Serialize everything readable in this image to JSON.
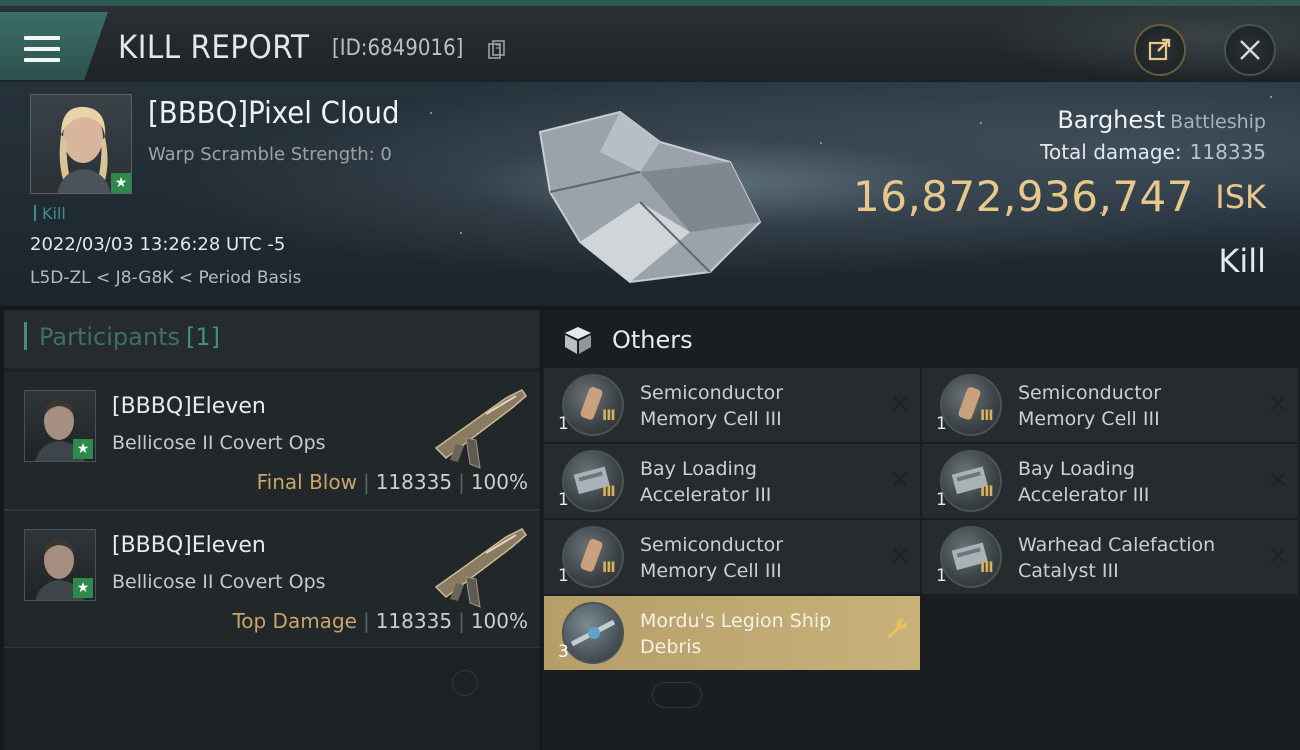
{
  "header": {
    "title": "KILL REPORT",
    "report_id": "[ID:6849016]"
  },
  "victim": {
    "name": "[BBBQ]Pixel Cloud",
    "warp_scramble": "Warp Scramble Strength: 0",
    "tag": "Kill",
    "timestamp": "2022/03/03 13:26:28 UTC -5",
    "location": "L5D-ZL < J8-G8K < Period Basis",
    "ship_name": "Barghest",
    "ship_class": "Battleship",
    "total_damage_label": "Total damage:",
    "total_damage_value": "118335",
    "isk_value": "16,872,936,747",
    "isk_unit": "ISK",
    "result": "Kill"
  },
  "participants": {
    "title": "Participants",
    "count": "[1]",
    "rows": [
      {
        "name": "[BBBQ]Eleven",
        "ship": "Bellicose II Covert Ops",
        "role": "Final Blow",
        "damage": "118335",
        "percent": "100%"
      },
      {
        "name": "[BBBQ]Eleven",
        "ship": "Bellicose II Covert Ops",
        "role": "Top Damage",
        "damage": "118335",
        "percent": "100%"
      }
    ]
  },
  "others": {
    "title": "Others",
    "items": [
      {
        "qty": "1",
        "line1": "Semiconductor",
        "line2": "Memory Cell III",
        "tier": "III",
        "icon": "memory-cell-icon"
      },
      {
        "qty": "1",
        "line1": "Semiconductor",
        "line2": "Memory Cell III",
        "tier": "III",
        "icon": "memory-cell-icon"
      },
      {
        "qty": "1",
        "line1": "Bay Loading",
        "line2": "Accelerator III",
        "tier": "III",
        "icon": "accelerator-icon"
      },
      {
        "qty": "1",
        "line1": "Bay Loading",
        "line2": "Accelerator III",
        "tier": "III",
        "icon": "accelerator-icon"
      },
      {
        "qty": "1",
        "line1": "Semiconductor",
        "line2": "Memory Cell III",
        "tier": "III",
        "icon": "memory-cell-icon"
      },
      {
        "qty": "1",
        "line1": "Warhead Calefaction",
        "line2": "Catalyst III",
        "tier": "III",
        "icon": "catalyst-icon"
      },
      {
        "qty": "3",
        "line1": "Mordu's Legion Ship",
        "line2": "Debris",
        "tier": "",
        "icon": "debris-icon"
      }
    ]
  },
  "colors": {
    "accent_teal": "#3f8f86",
    "isk_gold": "#e7c88a",
    "highlight_gold": "#c8b27a",
    "role_gold": "#c7a56c"
  }
}
